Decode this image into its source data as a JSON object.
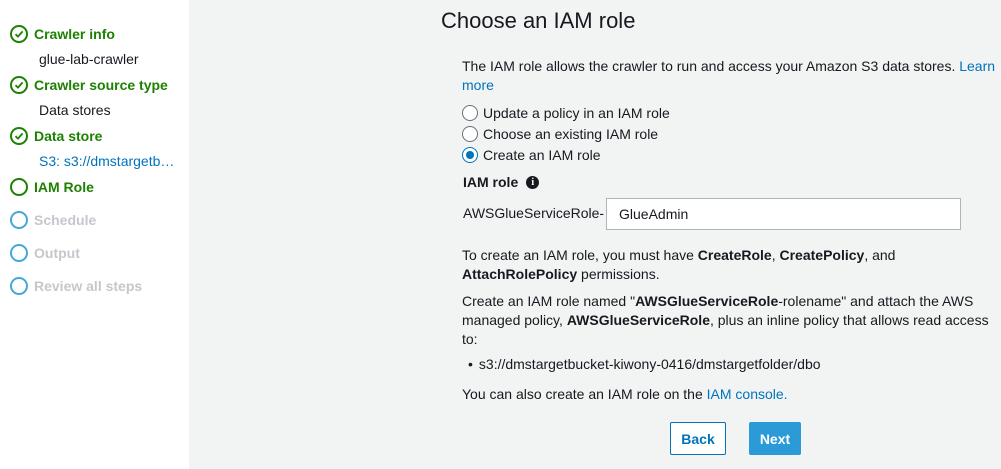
{
  "sidebar": {
    "steps": [
      {
        "label": "Crawler info",
        "state": "done",
        "sub": "glue-lab-crawler"
      },
      {
        "label": "Crawler source type",
        "state": "done",
        "sub": "Data stores"
      },
      {
        "label": "Data store",
        "state": "done",
        "sub": "S3: s3://dmstargetb…"
      },
      {
        "label": "IAM Role",
        "state": "current"
      },
      {
        "label": "Schedule",
        "state": "pending"
      },
      {
        "label": "Output",
        "state": "pending"
      },
      {
        "label": "Review all steps",
        "state": "pending"
      }
    ]
  },
  "main": {
    "title": "Choose an IAM role",
    "intro_text": "The IAM role allows the crawler to run and access your Amazon S3 data stores.",
    "intro_link": "Learn more",
    "radio_options": [
      {
        "label": "Update a policy in an IAM role",
        "checked": false
      },
      {
        "label": "Choose an existing IAM role",
        "checked": false
      },
      {
        "label": "Create an IAM role",
        "checked": true
      }
    ],
    "iam_role_label": "IAM role",
    "role_prefix": "AWSGlueServiceRole-",
    "role_value": "GlueAdmin",
    "permissions_text": {
      "p1": "To create an IAM role, you must have ",
      "b1": "CreateRole",
      "p2": ", ",
      "b2": "CreatePolicy",
      "p3": ", and ",
      "b3": "AttachRolePolicy",
      "p4": " permissions."
    },
    "create_text": {
      "p1": "Create an IAM role named \"",
      "b1": "AWSGlueServiceRole",
      "p2": "-rolename\" and attach the AWS managed policy, ",
      "b2": "AWSGlueServiceRole",
      "p3": ", plus an inline policy that allows read access to:"
    },
    "s3_path": "s3://dmstargetbucket-kiwony-0416/dmstargetfolder/dbo",
    "console_text": "You can also create an IAM role on the ",
    "console_link": "IAM console.",
    "back_label": "Back",
    "next_label": "Next"
  }
}
